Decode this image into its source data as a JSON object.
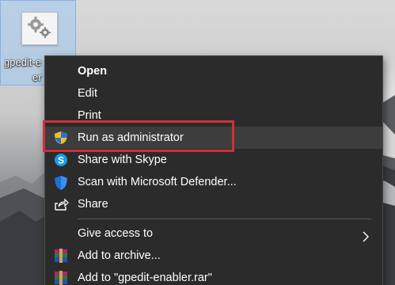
{
  "desktop_icon": {
    "label_line1": "gpedit-e",
    "label_line2": "er"
  },
  "menu": {
    "items": [
      {
        "label": "Open",
        "icon": "none",
        "bold": true
      },
      {
        "label": "Edit",
        "icon": "none"
      },
      {
        "label": "Print",
        "icon": "none"
      },
      {
        "label": "Run as administrator",
        "icon": "uac-shield-icon",
        "highlighted": true
      },
      {
        "label": "Share with Skype",
        "icon": "skype-icon"
      },
      {
        "label": "Scan with Microsoft Defender...",
        "icon": "defender-shield-icon"
      },
      {
        "label": "Share",
        "icon": "share-icon"
      },
      {
        "label": "Give access to",
        "icon": "chevron-right-icon",
        "submenu": true
      },
      {
        "label": "Add to archive...",
        "icon": "winrar-icon"
      },
      {
        "label": "Add to \"gpedit-enabler.rar\"",
        "icon": "winrar-icon"
      }
    ]
  },
  "colors": {
    "menu_bg": "#2b2b2b",
    "highlight_border": "#d0303a",
    "text": "#ffffff"
  }
}
